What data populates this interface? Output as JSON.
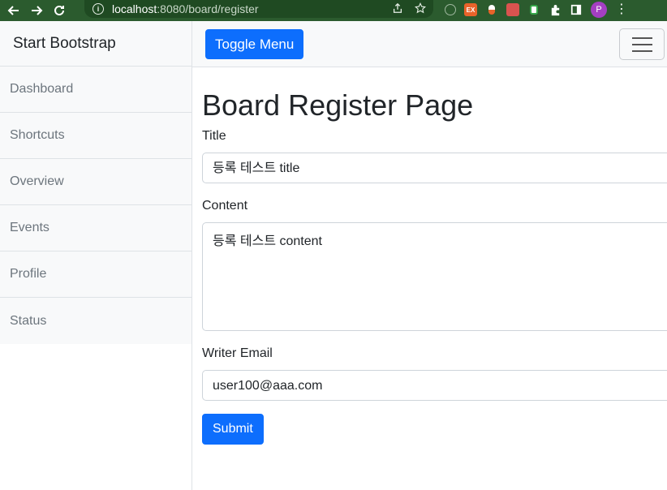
{
  "browser": {
    "url_host": "localhost",
    "url_rest": ":8080/board/register",
    "profile_initial": "P",
    "extension_badge": "EX"
  },
  "sidebar": {
    "heading": "Start Bootstrap",
    "items": [
      {
        "label": "Dashboard"
      },
      {
        "label": "Shortcuts"
      },
      {
        "label": "Overview"
      },
      {
        "label": "Events"
      },
      {
        "label": "Profile"
      },
      {
        "label": "Status"
      }
    ]
  },
  "topnav": {
    "toggle_label": "Toggle Menu"
  },
  "form": {
    "page_title": "Board Register Page",
    "title_label": "Title",
    "title_value": "등록 테스트 title",
    "content_label": "Content",
    "content_value": "등록 테스트 content",
    "writer_label": "Writer Email",
    "writer_value": "user100@aaa.com",
    "submit_label": "Submit"
  },
  "colors": {
    "chrome": "#2b5b2e",
    "primary": "#0d6efd"
  }
}
